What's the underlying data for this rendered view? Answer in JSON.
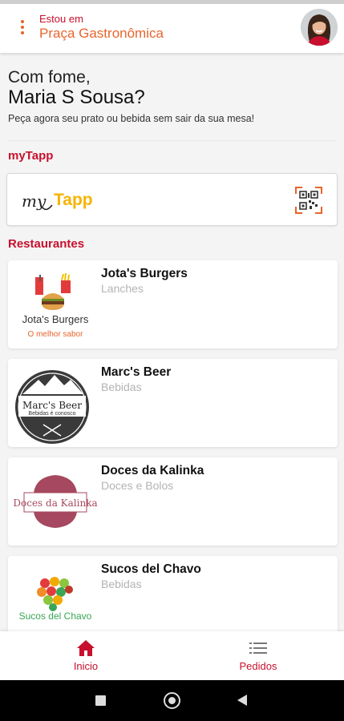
{
  "header": {
    "location_label": "Estou em",
    "location_name": "Praça Gastronômica"
  },
  "greeting": {
    "line1": "Com fome,",
    "line2": "Maria S Sousa?",
    "subtitle": "Peça agora seu prato ou bebida sem sair da sua mesa!"
  },
  "mytapp": {
    "section_title": "myTapp",
    "logo_text_my": "my",
    "logo_text_tapp": "Tapp"
  },
  "restaurants": {
    "section_title": "Restaurantes",
    "items": [
      {
        "name": "Jota's Burgers",
        "category": "Lanches",
        "logo_text": "Jota's Burgers",
        "logo_subtext": "O melhor sabor"
      },
      {
        "name": "Marc's Beer",
        "category": "Bebidas",
        "logo_text": "Marc's Beer",
        "logo_subtext": "Bebidas é conosco"
      },
      {
        "name": "Doces da Kalinka",
        "category": "Doces e Bolos",
        "logo_text": "Doces da Kalinka"
      },
      {
        "name": "Sucos del Chavo",
        "category": "Bebidas",
        "logo_text": "Sucos del Chavo"
      }
    ]
  },
  "bottom_nav": {
    "home_label": "Inicio",
    "orders_label": "Pedidos"
  },
  "colors": {
    "brand_red": "#c8102e",
    "accent_orange": "#e8642c",
    "mytapp_yellow": "#f5b400"
  }
}
